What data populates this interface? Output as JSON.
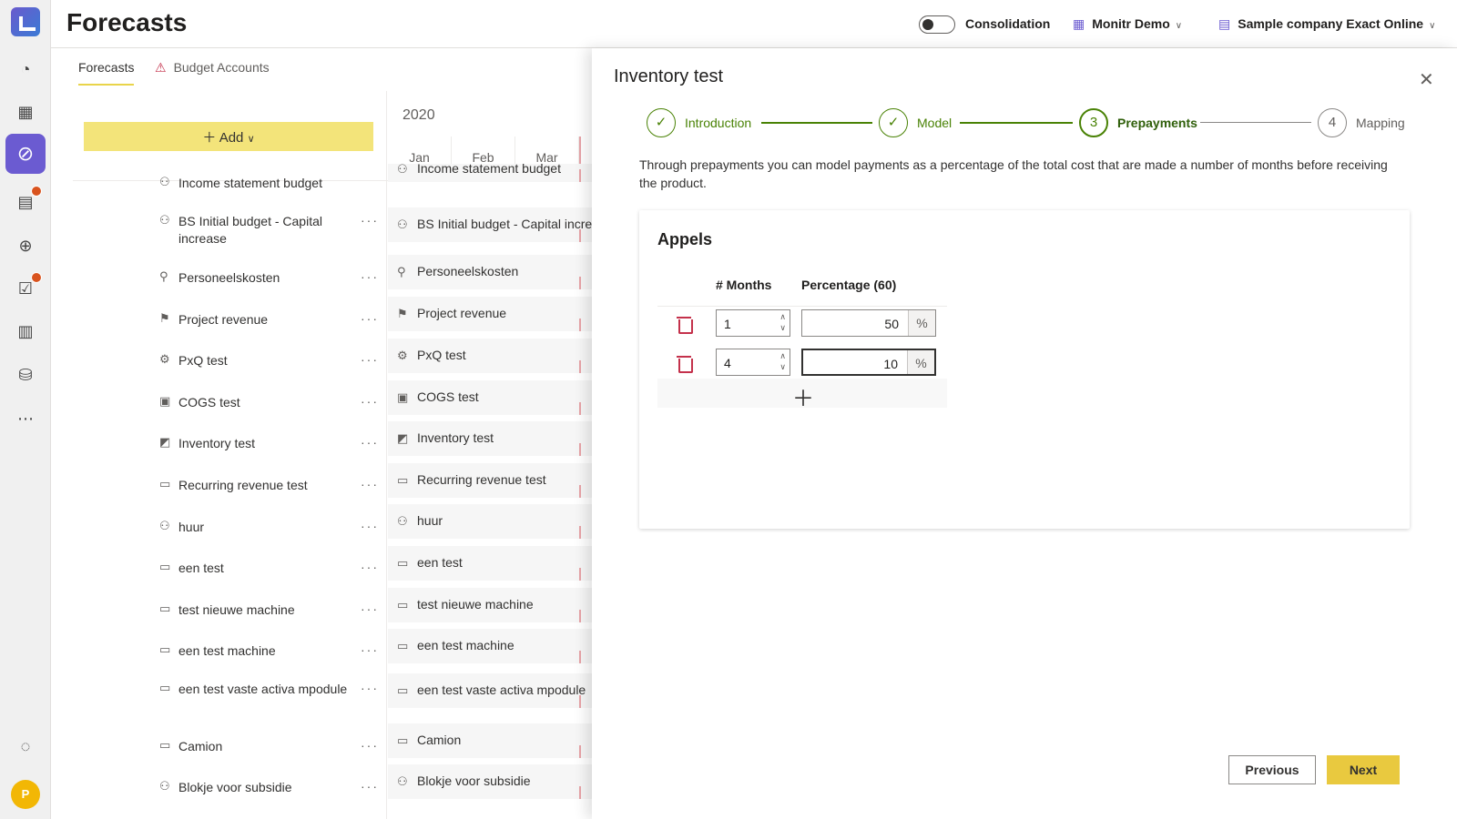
{
  "header": {
    "title": "Forecasts",
    "consolidation_label": "Consolidation",
    "tenant": "Monitr Demo",
    "company": "Sample company Exact Online"
  },
  "tabs": [
    {
      "label": "Forecasts",
      "active": true
    },
    {
      "label": "Budget Accounts",
      "active": false
    }
  ],
  "toolbar": {
    "add_label": "Add"
  },
  "timeline": {
    "year": "2020",
    "months": [
      "Jan",
      "Feb",
      "Mar"
    ]
  },
  "forecast_list": [
    "Income statement budget",
    "BS Initial budget - Capital increase",
    "Personeelskosten",
    "Project revenue",
    "PxQ test",
    "COGS test",
    "Inventory test",
    "Recurring revenue test",
    "huur",
    "een test",
    "test nieuwe machine",
    "een test machine",
    "een test vaste activa mpodule",
    "Camion",
    "Blokje voor subsidie"
  ],
  "grid_rows": [
    "Income statement budget",
    "BS Initial budget - Capital increa",
    "Personeelskosten",
    "Project revenue",
    "PxQ test",
    "COGS test",
    "Inventory test",
    "Recurring revenue test",
    "huur",
    "een test",
    "test nieuwe machine",
    "een test machine",
    "een test vaste activa mpodule",
    "Camion",
    "Blokje voor subsidie"
  ],
  "panel": {
    "title": "Inventory test",
    "steps": [
      {
        "label": "Introduction",
        "number": "",
        "state": "done"
      },
      {
        "label": "Model",
        "number": "",
        "state": "done"
      },
      {
        "label": "Prepayments",
        "number": "3",
        "state": "current"
      },
      {
        "label": "Mapping",
        "number": "4",
        "state": "todo"
      }
    ],
    "description": "Through prepayments you can model payments as a percentage of the total cost that are made a number of months before receiving the product.",
    "card": {
      "title": "Appels",
      "col_months": "# Months",
      "col_percentage": "Percentage (60)",
      "rows": [
        {
          "months": "1",
          "percentage": "50"
        },
        {
          "months": "4",
          "percentage": "10"
        }
      ],
      "percent_suffix": "%"
    },
    "previous_label": "Previous",
    "next_label": "Next"
  },
  "colors": {
    "accent": "#6b5bd1",
    "add": "#f3e47a",
    "next": "#e9c93f",
    "step": "#498205",
    "danger": "#c4314b"
  },
  "user": {
    "initial": "P"
  }
}
